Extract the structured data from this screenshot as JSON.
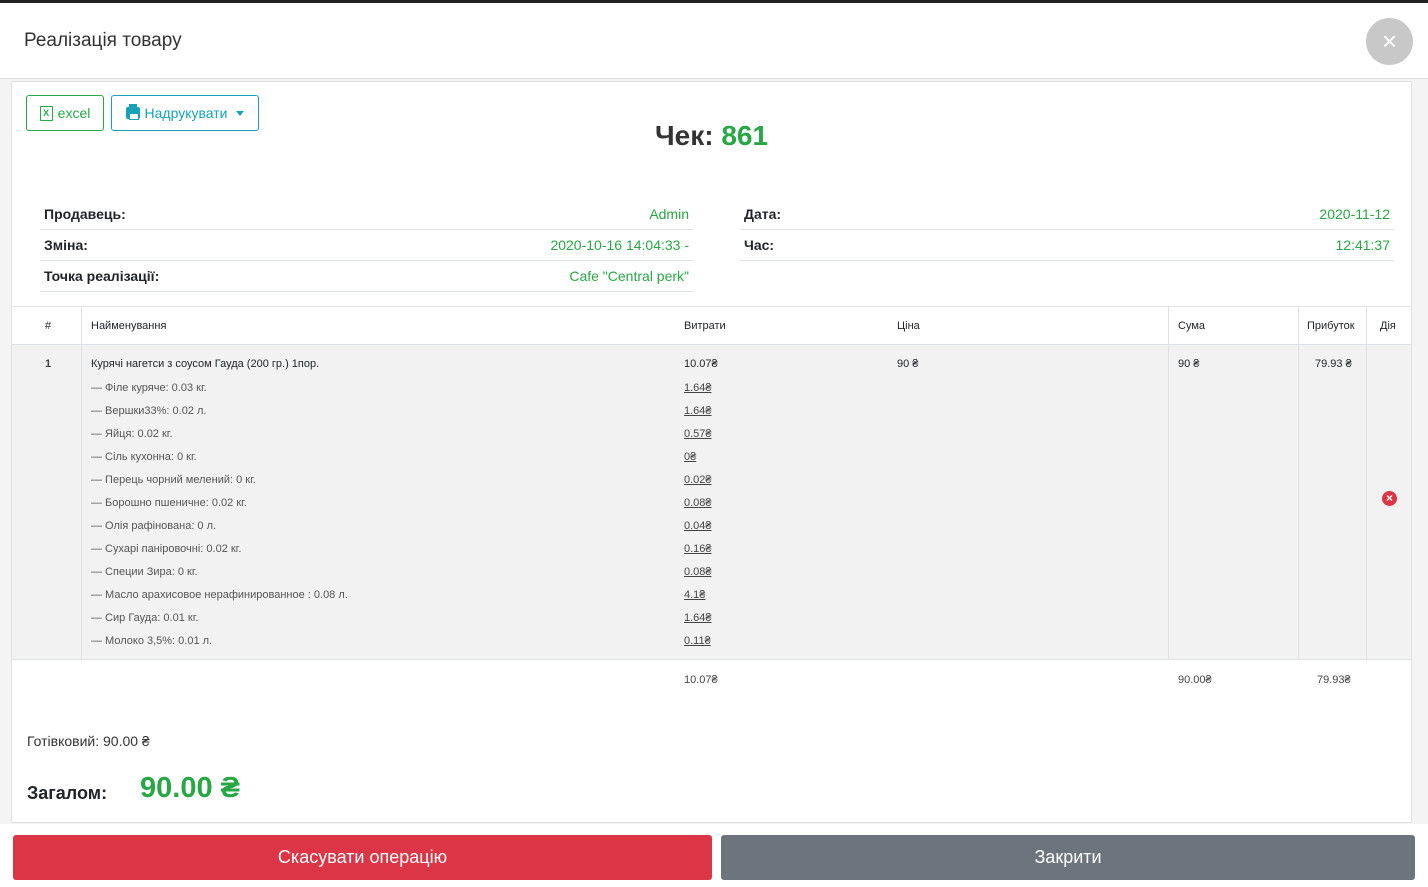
{
  "modal": {
    "title": "Реалізація товару",
    "close_symbol": "×"
  },
  "toolbar": {
    "excel_label": "excel",
    "excel_icon": "X",
    "print_label": "Надрукувати"
  },
  "receipt": {
    "label": "Чек:",
    "number": "861"
  },
  "info_left": [
    {
      "label": "Продавець:",
      "value": "Admin"
    },
    {
      "label": "Зміна:",
      "value": "2020-10-16 14:04:33 -"
    },
    {
      "label": "Точка реалізації:",
      "value": "Cafe \"Central perk\""
    }
  ],
  "info_right": [
    {
      "label": "Дата:",
      "value": "2020-11-12"
    },
    {
      "label": "Час:",
      "value": "12:41:37"
    }
  ],
  "table": {
    "headers": {
      "num": "#",
      "name": "Найменування",
      "cost": "Витрати",
      "price": "Ціна",
      "sum": "Сума",
      "profit": "Прибуток",
      "action": "Дія"
    },
    "item": {
      "num": "1",
      "name": "Курячі нагетси з соусом Гауда (200 гр.)",
      "portion": " 1пор.",
      "cost": "10.07₴",
      "price": "90 ₴",
      "sum": "90 ₴",
      "profit": "79.93 ₴",
      "ingredients": [
        {
          "name": "—  Філе куряче: 0.03 кг.",
          "cost": "1.64₴"
        },
        {
          "name": "—  Вершки33%: 0.02 л.",
          "cost": "1.64₴"
        },
        {
          "name": "—  Яйця: 0.02 кг.",
          "cost": "0.57₴"
        },
        {
          "name": "—  Сіль кухонна: 0 кг.",
          "cost": "0₴"
        },
        {
          "name": "—  Перець чорний мелений: 0 кг.",
          "cost": "0.02₴"
        },
        {
          "name": "—  Борошно пшеничне: 0.02 кг.",
          "cost": "0.08₴"
        },
        {
          "name": "—  Олія рафінована: 0 л.",
          "cost": "0.04₴"
        },
        {
          "name": "—  Сухарі паніровочні: 0.02 кг.",
          "cost": "0.16₴"
        },
        {
          "name": "—  Специи Зира: 0 кг.",
          "cost": "0.08₴"
        },
        {
          "name": "—  Масло арахисовое нерафинированное : 0.08 л.",
          "cost": "4.1₴"
        },
        {
          "name": "—  Сир Гауда: 0.01 кг.",
          "cost": "1.64₴"
        },
        {
          "name": "—  Молоко 3,5%: 0.01 л.",
          "cost": "0.11₴"
        }
      ]
    },
    "totals": {
      "cost": "10.07₴",
      "sum": "90.00₴",
      "profit": "79.93₴"
    }
  },
  "payment": {
    "cash": "Готівковий: 90.00 ₴"
  },
  "total": {
    "label": "Загалом:",
    "value": "90.00 ₴"
  },
  "actions": {
    "cancel": "Скасувати операцію",
    "close": "Закрити"
  },
  "colors": {
    "accent": "#28a745",
    "danger": "#dc3545",
    "secondary": "#6c757d",
    "info": "#17a2b8"
  }
}
